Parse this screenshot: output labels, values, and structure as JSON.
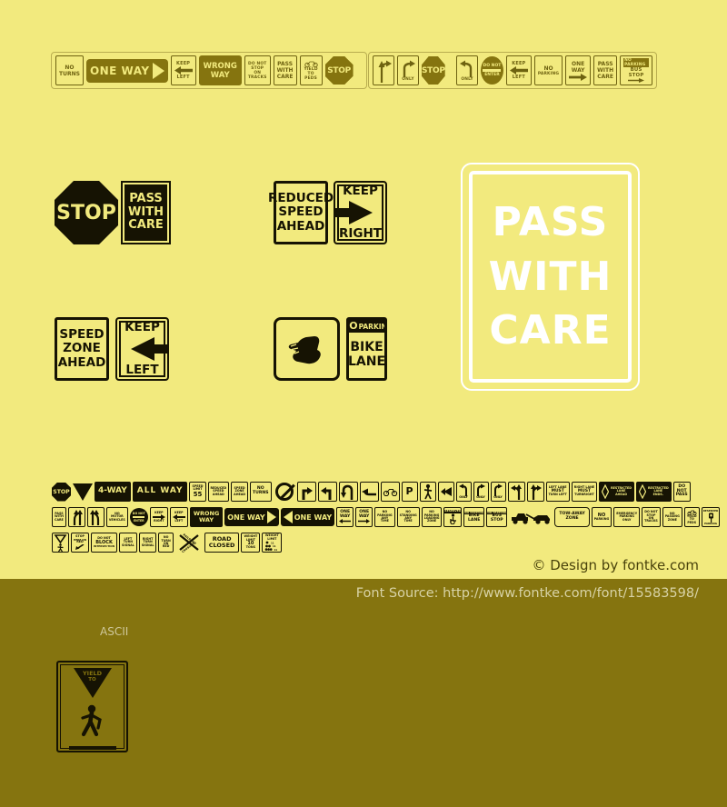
{
  "page": {
    "background_color": "#f2ea7e",
    "footer_color": "#85740f",
    "dark_ink": "#161303",
    "white": "#ffffff"
  },
  "top_strip_left": {
    "signs": [
      {
        "id": "no-turns",
        "lines": [
          "NO",
          "TURNS"
        ],
        "style": "outline"
      },
      {
        "id": "one-way-right",
        "lines": [
          "ONE WAY"
        ],
        "style": "filled-arrow-right"
      },
      {
        "id": "keep-left",
        "lines": [
          "KEEP",
          "LEFT"
        ],
        "style": "outline-arrow-left"
      },
      {
        "id": "wrong-way",
        "lines": [
          "WRONG",
          "WAY"
        ],
        "style": "filled"
      },
      {
        "id": "do-not-stop-on-tracks",
        "lines": [
          "DO NOT",
          "STOP",
          "ON",
          "TRACKS"
        ],
        "style": "outline"
      },
      {
        "id": "pass-with-care",
        "lines": [
          "PASS",
          "WITH",
          "CARE"
        ],
        "style": "outline"
      },
      {
        "id": "yield-to-peds",
        "lines": [
          "YIELD",
          "TO",
          "PEDS"
        ],
        "style": "outline-bike"
      },
      {
        "id": "stop",
        "lines": [
          "STOP"
        ],
        "style": "octagon"
      }
    ]
  },
  "top_strip_right": {
    "signs": [
      {
        "id": "straight-or-right",
        "lines": [],
        "style": "outline-arrow-split"
      },
      {
        "id": "right-turn-only",
        "lines": [
          "ONLY"
        ],
        "style": "outline-curve-right"
      },
      {
        "id": "stop",
        "lines": [
          "STOP"
        ],
        "style": "octagon"
      },
      {
        "id": "left-turn-only",
        "lines": [
          "ONLY"
        ],
        "style": "outline-curve-left"
      },
      {
        "id": "do-not-enter",
        "lines": [
          "DO NOT",
          "ENTER"
        ],
        "style": "circle"
      },
      {
        "id": "keep-left",
        "lines": [
          "KEEP",
          "LEFT"
        ],
        "style": "outline-arrow-left"
      },
      {
        "id": "no-parking",
        "lines": [
          "NO",
          "PARKING"
        ],
        "style": "outline"
      },
      {
        "id": "one-way-right",
        "lines": [
          "ONE",
          "WAY"
        ],
        "style": "outline-arrow-right"
      },
      {
        "id": "pass-with-care",
        "lines": [
          "PASS",
          "WITH",
          "CARE"
        ],
        "style": "outline"
      },
      {
        "id": "no-parking-bus-stop",
        "lines": [
          "NO PARKING",
          "BUS",
          "STOP"
        ],
        "style": "outline"
      }
    ]
  },
  "samples": {
    "stop": {
      "label": "STOP",
      "shape": "octagon",
      "colors": "black-on-yellow"
    },
    "pass_with_care": {
      "lines": [
        "PASS",
        "WITH",
        "CARE"
      ],
      "shape": "rect",
      "colors": "black-fill"
    },
    "reduced_speed_ahead": {
      "lines": [
        "REDUCED",
        "SPEED",
        "AHEAD"
      ],
      "shape": "rect",
      "colors": "yellow-fill"
    },
    "keep_right": {
      "lines": [
        "KEEP",
        "RIGHT"
      ],
      "arrow": "right",
      "shape": "rect"
    },
    "speed_zone_ahead": {
      "lines": [
        "SPEED",
        "ZONE",
        "AHEAD"
      ],
      "shape": "rect"
    },
    "keep_left": {
      "lines": [
        "KEEP",
        "LEFT"
      ],
      "arrow": "left",
      "shape": "rect"
    },
    "hitchhike_thumb": {
      "lines": [],
      "icon": "thumb-hand",
      "shape": "rounded-rect"
    },
    "no_parking_bike_lane": {
      "header": [
        "NO",
        "PARKING"
      ],
      "lines": [
        "BIKE",
        "LANE"
      ],
      "shape": "rect"
    },
    "giant": {
      "lines": [
        "PASS",
        "WITH",
        "CARE"
      ],
      "colors": "white-on-yellow"
    }
  },
  "glyph_rows": [
    {
      "row": 1,
      "items": [
        {
          "id": "stop-octagon",
          "text": "STOP"
        },
        {
          "id": "yield-triangle",
          "text": ""
        },
        {
          "id": "4-way",
          "text": "4-WAY"
        },
        {
          "id": "all-way",
          "text": "ALL WAY"
        },
        {
          "id": "speed-limit-55",
          "text": "SPEED LIMIT 55"
        },
        {
          "id": "reduced-speed-ahead",
          "text": "REDUCED SPEED AHEAD"
        },
        {
          "id": "speed-zone-ahead",
          "text": "SPEED ZONE AHEAD"
        },
        {
          "id": "no-turns",
          "text": "NO TURNS"
        },
        {
          "id": "no-entry-slash",
          "text": ""
        },
        {
          "id": "right-turn-arrow",
          "text": ""
        },
        {
          "id": "left-turn-arrow",
          "text": ""
        },
        {
          "id": "u-turn-arrow",
          "text": ""
        },
        {
          "id": "merge-arrow",
          "text": ""
        },
        {
          "id": "bicycle",
          "text": ""
        },
        {
          "id": "parking-p",
          "text": "P"
        },
        {
          "id": "pedestrian",
          "text": ""
        },
        {
          "id": "hand-pointing",
          "text": ""
        },
        {
          "id": "left-only-curve",
          "text": "ONLY"
        },
        {
          "id": "right-only-curve",
          "text": "ONLY"
        },
        {
          "id": "right-only-curve-2",
          "text": "ONLY"
        },
        {
          "id": "left-lane-must-turn-left-arrow",
          "text": ""
        },
        {
          "id": "right-lane-must-turn-right-arrow",
          "text": ""
        },
        {
          "id": "left-lane-must-turn-left",
          "text": "LEFT LANE MUST TURN LEFT"
        },
        {
          "id": "right-lane-must-turn-right",
          "text": "RIGHT LANE MUST TURN RIGHT"
        },
        {
          "id": "restricted-lane-ahead",
          "text": "RESTRICTED LANE AHEAD"
        },
        {
          "id": "restricted-lane-ends",
          "text": "RESTRICTED LANE ENDS"
        },
        {
          "id": "do-not-pass",
          "text": "DO NOT PASS"
        }
      ]
    },
    {
      "row": 2,
      "items": [
        {
          "id": "pass-with-care",
          "text": "PASS WITH CARE"
        },
        {
          "id": "lane-merge-left",
          "text": ""
        },
        {
          "id": "lane-merge-right",
          "text": ""
        },
        {
          "id": "no-motor-vehicles",
          "text": "NO MOTOR VEHICLES"
        },
        {
          "id": "do-not-enter-circle",
          "text": "DO NOT ENTER"
        },
        {
          "id": "keep-right",
          "text": "KEEP RIGHT"
        },
        {
          "id": "keep-left",
          "text": "KEEP LEFT"
        },
        {
          "id": "wrong-way",
          "text": "WRONG WAY"
        },
        {
          "id": "one-way-right-long",
          "text": "ONE WAY"
        },
        {
          "id": "one-way-left-long",
          "text": "ONE WAY"
        },
        {
          "id": "one-way-left-small",
          "text": "ONE WAY"
        },
        {
          "id": "one-way-right-small",
          "text": "ONE WAY"
        },
        {
          "id": "no-parking-any-time",
          "text": "NO PARKING ANY TIME"
        },
        {
          "id": "no-standing-any-time",
          "text": "NO STANDING ANY TIME"
        },
        {
          "id": "no-parking-loading-zone",
          "text": "NO PARKING LOADING ZONE"
        },
        {
          "id": "reserved-parking-handicap",
          "text": "RESERVED PARKING"
        },
        {
          "id": "no-parking-bike-lane",
          "text": "NO PARKING BIKE LANE"
        },
        {
          "id": "no-parking-bus-stop",
          "text": "NO PARKING BUS STOP"
        },
        {
          "id": "tow-truck",
          "text": ""
        },
        {
          "id": "tow-away-zone",
          "text": "TOW-AWAY ZONE"
        },
        {
          "id": "no-parking",
          "text": "NO PARKING"
        },
        {
          "id": "emergency-parking-only",
          "text": "EMERGENCY PARKING ONLY"
        },
        {
          "id": "do-not-stop-on-tracks",
          "text": "DO NOT STOP ON TRACKS"
        },
        {
          "id": "no-passing-zone",
          "text": "NO PASSING ZONE"
        },
        {
          "id": "yield-to-peds-bike",
          "text": "YIELD TO PEDS"
        },
        {
          "id": "parking-meter",
          "text": ""
        }
      ]
    },
    {
      "row": 3,
      "items": [
        {
          "id": "yield-here-to-pedestrians",
          "text": ""
        },
        {
          "id": "stop-here-on-red",
          "text": "STOP HERE ON RED"
        },
        {
          "id": "do-not-block-intersection",
          "text": "DO NOT BLOCK INTERSECTION"
        },
        {
          "id": "left-turn-signal",
          "text": "LEFT TURN SIGNAL"
        },
        {
          "id": "right-turn-signal",
          "text": "RIGHT TURN SIGNAL"
        },
        {
          "id": "no-turn-on-red",
          "text": "NO TURN ON RED"
        },
        {
          "id": "railroad-crossbuck",
          "text": "RAILROAD CROSSING"
        },
        {
          "id": "road-closed",
          "text": "ROAD CLOSED"
        },
        {
          "id": "weight-limit-10-tons",
          "text": "WEIGHT LIMIT 10 TONS"
        },
        {
          "id": "weight-limit-axle",
          "text": "WEIGHT LIMIT"
        }
      ]
    }
  ],
  "footer": {
    "credit": "© Design by fontke.com",
    "font_source": "Font Source: http://www.fontke.com/font/15583598/",
    "encoding_label": "ASCII"
  },
  "bottom_sign": {
    "id": "yield-to-pedestrians",
    "lines": [
      "YIELD",
      "TO"
    ],
    "icon": "pedestrian-walking"
  }
}
